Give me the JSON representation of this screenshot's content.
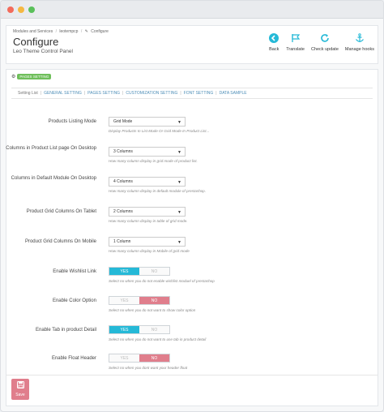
{
  "breadcrumb": [
    "Modules and Services",
    "leotempcp",
    "Configure"
  ],
  "page": {
    "title": "Configure",
    "subtitle": "Leo Theme Control Panel"
  },
  "actions": [
    {
      "label": "Back",
      "icon": "back-arrow-icon"
    },
    {
      "label": "Translate",
      "icon": "flag-icon"
    },
    {
      "label": "Check update",
      "icon": "refresh-icon"
    },
    {
      "label": "Manage hooks",
      "icon": "anchor-icon"
    }
  ],
  "section": {
    "badge": "PAGES SETTING"
  },
  "tabs": [
    "Setting List",
    "GENERAL SETTING",
    "PAGES SETTING",
    "CUSTOMIZATION SETTING",
    "FONT SETTING",
    "DATA SAMPLE"
  ],
  "selects": [
    {
      "label": "Products Listing Mode",
      "value": "Grid Mode",
      "help": "Display Products In List Mode Or Grid Mode In Product List..."
    },
    {
      "label": "Columns in Product List page On Desktop",
      "value": "3 Columns",
      "help": "How many column display in grid mode of product list."
    },
    {
      "label": "Columns in Default Module On Desktop",
      "value": "4 Columns",
      "help": "How many column display in default module of prestashop."
    },
    {
      "label": "Product Grid Columns On Tablet",
      "value": "2 Columns",
      "help": "How many column display in table of grid mode."
    },
    {
      "label": "Product Grid Columns On Mobile",
      "value": "1 Column",
      "help": "How many column display in Mobile of grid mode"
    }
  ],
  "toggles": [
    {
      "label": "Enable Wishlist Link",
      "yes": "YES",
      "no": "NO",
      "state": "yes",
      "help": "Select no when you do not enable wishlist moduel of prestashop"
    },
    {
      "label": "Enable Color Option",
      "yes": "YES",
      "no": "NO",
      "state": "no",
      "help": "Select no when you do not want to show color option"
    },
    {
      "label": "Enable Tab in product Detail",
      "yes": "YES",
      "no": "NO",
      "state": "yes",
      "help": "Select no when you do not want to use tab in product detail"
    },
    {
      "label": "Enable Float Header",
      "yes": "YES",
      "no": "NO",
      "state": "no",
      "help": "Select no when you dont want your header float"
    }
  ],
  "save_label": "Save",
  "colors": {
    "accent": "#25b9d7",
    "danger": "#e07e8c",
    "badge": "#6fbf5b"
  }
}
